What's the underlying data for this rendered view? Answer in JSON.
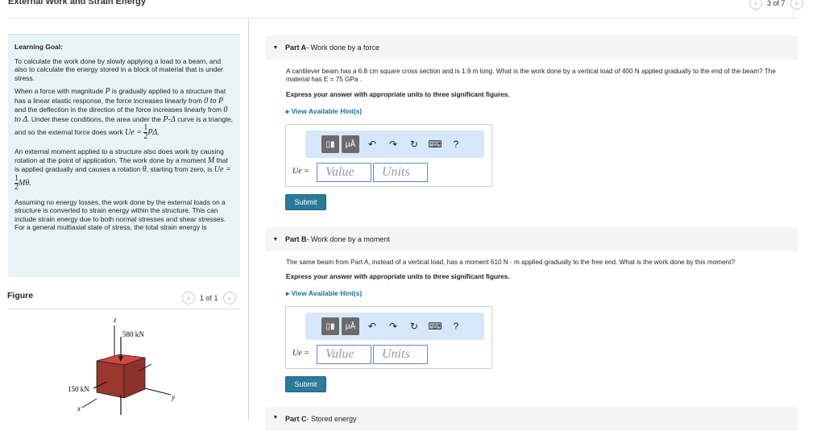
{
  "header": {
    "title": "External Work and Strain Energy",
    "pager": "3 of 7"
  },
  "goal": {
    "heading": "Learning Goal:",
    "p1": "To calculate the work done by slowly applying a load to a beam, and also to calculate the energy stored in a block of material that is under stress.",
    "p2a": "When a force with magnitude ",
    "p2b": " is gradually applied to a structure that has a linear elastic response, the force increases linearly from ",
    "p2c": " and the deflection in the direction of the force increases linearly from ",
    "p2d": ". Under these conditions, the area under the ",
    "p2e": " curve is a triangle, and so the external force does work ",
    "p3a": "An external moment applied to a structure also does work by causing rotation at the point of application. The work done by a moment ",
    "p3b": " that is applied gradually and causes a rotation ",
    "p3c": ", starting from zero, is ",
    "p4": "Assuming no energy losses, the work done by the external loads on a structure is converted to strain energy within the structure. This can include strain energy due to both normal stresses and shear stresses. For a general multiaxial state of stress, the total strain energy is",
    "math": {
      "P": "P",
      "zeroP": "0 to P",
      "zeroD": "0 to Δ",
      "PD": "P-Δ",
      "Ue": "Ue =",
      "one": "1",
      "two": "2",
      "PDelta": "PΔ.",
      "M": "M",
      "theta": "θ",
      "Mtheta": "Mθ."
    }
  },
  "figure": {
    "title": "Figure",
    "pager": "1 of 1",
    "labels": {
      "z": "z",
      "y": "y",
      "x": "x",
      "load1": "580 kN",
      "load2": "150 kN"
    }
  },
  "partA": {
    "label": "Part A",
    "title": " - Work done by a force",
    "question": "A cantilever beam has a 6.8 cm square cross section and is 1.9 m long. What is the work done by a vertical load of 400 N applied gradually to the end of the beam? The material has E = 75 GPa .",
    "instruction": "Express your answer with appropriate units to three significant figures.",
    "hint": "View Available Hint(s)",
    "var": "Ue =",
    "value_ph": "Value",
    "units_ph": "Units",
    "submit": "Submit"
  },
  "partB": {
    "label": "Part B",
    "title": " - Work done by a moment",
    "question": "The same beam from Part A, instead of a vertical load, has a moment 610 N · m applied gradually to the free end. What is the work done by this moment?",
    "instruction": "Express your answer with appropriate units to three significant figures.",
    "hint": "View Available Hint(s)",
    "var": "Ue =",
    "value_ph": "Value",
    "units_ph": "Units",
    "submit": "Submit"
  },
  "partC": {
    "label": "Part C",
    "title": " - Stored energy"
  },
  "toolbar": {
    "units_btn": "μÅ",
    "help": "?"
  },
  "colors": {
    "accent": "#2a7a9b",
    "goal_bg": "#e6f4f5",
    "cube": "#a33a34"
  }
}
